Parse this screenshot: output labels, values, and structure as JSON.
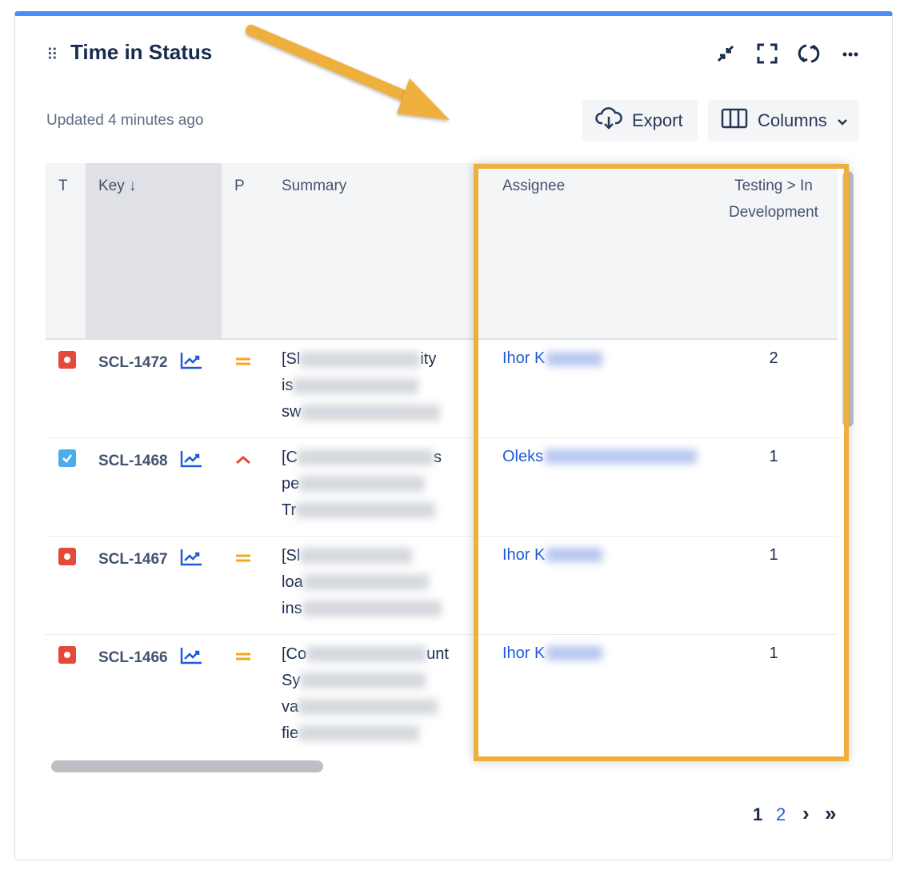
{
  "header": {
    "title": "Time in Status",
    "updated": "Updated 4 minutes ago",
    "export_label": "Export",
    "columns_label": "Columns"
  },
  "icons": {
    "drag": "drag-handle-icon",
    "minimize": "minimize-icon",
    "fullscreen": "fullscreen-icon",
    "refresh": "refresh-icon",
    "more": "more-icon",
    "export": "cloud-download-icon",
    "columns": "columns-icon",
    "chevron": "chevron-down-icon",
    "chart": "chart-trend-icon"
  },
  "table": {
    "headers": {
      "type": "T",
      "key": "Key ↓",
      "priority": "P",
      "summary": "Summary",
      "assignee": "Assignee",
      "status_time": "Testing > In Development"
    },
    "rows": [
      {
        "type": "bug",
        "key": "SCL-1472",
        "priority": "medium",
        "summary_lines": [
          "[Sl",
          "is",
          "sw"
        ],
        "summary_tail": "ity",
        "assignee": "Ihor K",
        "value": "2"
      },
      {
        "type": "task",
        "key": "SCL-1468",
        "priority": "high",
        "summary_lines": [
          "[C",
          "pe",
          "Tr"
        ],
        "summary_tail": "s",
        "assignee": "Oleks",
        "value": "1"
      },
      {
        "type": "bug",
        "key": "SCL-1467",
        "priority": "medium",
        "summary_lines": [
          "[Sl",
          "loa",
          "ins"
        ],
        "summary_tail": "",
        "assignee": "Ihor K",
        "value": "1"
      },
      {
        "type": "bug",
        "key": "SCL-1466",
        "priority": "medium",
        "summary_lines": [
          "[Co",
          "Sy",
          "va",
          "fie"
        ],
        "summary_tail": "unt",
        "assignee": "Ihor K",
        "value": "1"
      }
    ]
  },
  "pagination": {
    "current": "1",
    "next_page": "2",
    "next": "›",
    "last": "»"
  },
  "colors": {
    "accent": "#4c8df5",
    "highlight": "#eeaf3c",
    "bug": "#e5493a",
    "task": "#4bade8",
    "priority_medium": "#f5a623",
    "priority_high": "#e5493a",
    "link": "#1f5bd6"
  }
}
